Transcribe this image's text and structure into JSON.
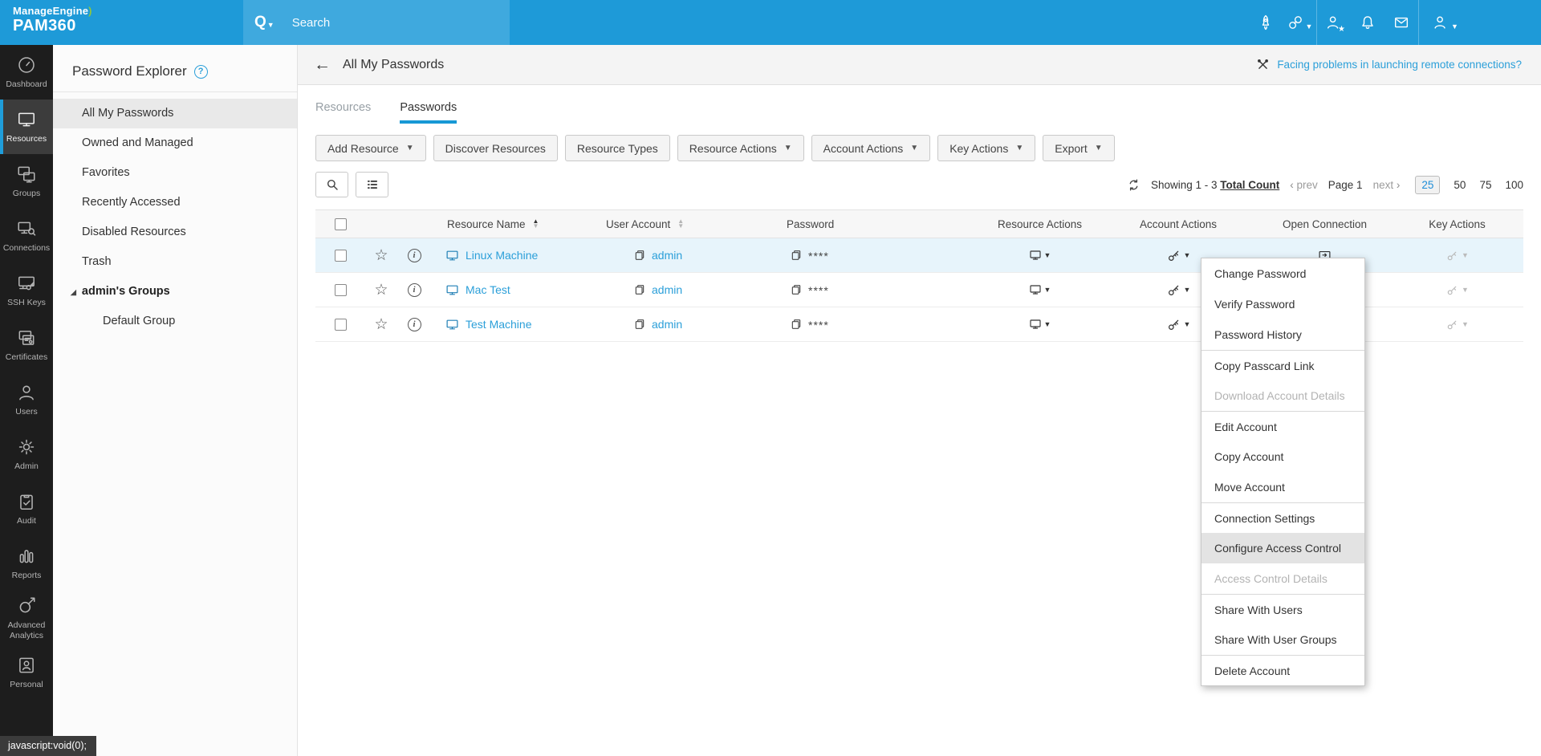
{
  "colors": {
    "topbar": "#1e9ad8",
    "accent": "#1f9dda",
    "link": "#2b9fd9",
    "row_highlight": "#e7f4fb",
    "brand_green": "#8dc63f"
  },
  "topbar": {
    "brand_line1": "ManageEngine",
    "brand_line2": "PAM360",
    "search_placeholder": "Search",
    "icons": [
      "rocket-icon",
      "link-icon",
      "user-star-icon",
      "bell-icon",
      "mail-icon",
      "user-icon"
    ]
  },
  "sidebar": {
    "items": [
      {
        "label": "Dashboard",
        "icon": "gauge-icon",
        "active": false
      },
      {
        "label": "Resources",
        "icon": "monitor-icon",
        "active": true
      },
      {
        "label": "Groups",
        "icon": "monitors-icon",
        "active": false
      },
      {
        "label": "Connections",
        "icon": "remote-connection-icon",
        "active": false
      },
      {
        "label": "SSH Keys",
        "icon": "ssh-key-icon",
        "active": false
      },
      {
        "label": "Certificates",
        "icon": "certificate-icon",
        "active": false
      },
      {
        "label": "Users",
        "icon": "person-icon",
        "active": false
      },
      {
        "label": "Admin",
        "icon": "gear-icon",
        "active": false
      },
      {
        "label": "Audit",
        "icon": "clipboard-check-icon",
        "active": false
      },
      {
        "label": "Reports",
        "icon": "bar-chart-icon",
        "active": false
      },
      {
        "label": "Advanced Analytics",
        "icon": "compass-icon",
        "active": false
      },
      {
        "label": "Personal",
        "icon": "id-card-icon",
        "active": false
      }
    ]
  },
  "explorer": {
    "title": "Password Explorer",
    "items": [
      {
        "label": "All My Passwords",
        "selected": true
      },
      {
        "label": "Owned and Managed",
        "selected": false
      },
      {
        "label": "Favorites",
        "selected": false
      },
      {
        "label": "Recently Accessed",
        "selected": false
      },
      {
        "label": "Disabled Resources",
        "selected": false
      },
      {
        "label": "Trash",
        "selected": false
      }
    ],
    "group": {
      "label": "admin's Groups",
      "expanded": true,
      "children": [
        {
          "label": "Default Group"
        }
      ]
    }
  },
  "header": {
    "title": "All My Passwords",
    "help_link": "Facing problems in launching remote connections?"
  },
  "tabs": [
    {
      "label": "Resources",
      "active": false
    },
    {
      "label": "Passwords",
      "active": true
    }
  ],
  "toolbar": [
    {
      "label": "Add Resource",
      "caret": true
    },
    {
      "label": "Discover Resources",
      "caret": false
    },
    {
      "label": "Resource Types",
      "caret": false
    },
    {
      "label": "Resource Actions",
      "caret": true
    },
    {
      "label": "Account Actions",
      "caret": true
    },
    {
      "label": "Key Actions",
      "caret": true
    },
    {
      "label": "Export",
      "caret": true
    }
  ],
  "pagination": {
    "showing": "Showing 1 - 3",
    "total_link": "Total Count",
    "prev_chev": "‹",
    "prev": "prev",
    "page": "Page 1",
    "next": "next",
    "next_chev": "›",
    "sizes": [
      "25",
      "50",
      "75",
      "100"
    ],
    "active_size": "25"
  },
  "table": {
    "columns": [
      "Resource Name",
      "User Account",
      "Password",
      "Resource Actions",
      "Account Actions",
      "Open Connection",
      "Key Actions"
    ],
    "rows": [
      {
        "name": "Linux Machine",
        "account": "admin",
        "password": "****",
        "highlighted": true
      },
      {
        "name": "Mac Test",
        "account": "admin",
        "password": "****",
        "highlighted": false
      },
      {
        "name": "Test Machine",
        "account": "admin",
        "password": "****",
        "highlighted": false
      }
    ]
  },
  "context_menu": {
    "items": [
      {
        "label": "Change Password",
        "disabled": false,
        "highlighted": false
      },
      {
        "label": "Verify Password",
        "disabled": false,
        "highlighted": false
      },
      {
        "label": "Password History",
        "disabled": false,
        "highlighted": false
      },
      {
        "label": "Copy Passcard Link",
        "disabled": false,
        "highlighted": false
      },
      {
        "label": "Download Account Details",
        "disabled": true,
        "highlighted": false
      },
      {
        "label": "Edit Account",
        "disabled": false,
        "highlighted": false
      },
      {
        "label": "Copy Account",
        "disabled": false,
        "highlighted": false
      },
      {
        "label": "Move Account",
        "disabled": false,
        "highlighted": false
      },
      {
        "label": "Connection Settings",
        "disabled": false,
        "highlighted": false
      },
      {
        "label": "Configure Access Control",
        "disabled": false,
        "highlighted": true
      },
      {
        "label": "Access Control Details",
        "disabled": true,
        "highlighted": false
      },
      {
        "label": "Share With Users",
        "disabled": false,
        "highlighted": false
      },
      {
        "label": "Share With User Groups",
        "disabled": false,
        "highlighted": false
      },
      {
        "label": "Delete Account",
        "disabled": false,
        "highlighted": false
      }
    ]
  },
  "statusbar": {
    "text": "javascript:void(0);"
  }
}
